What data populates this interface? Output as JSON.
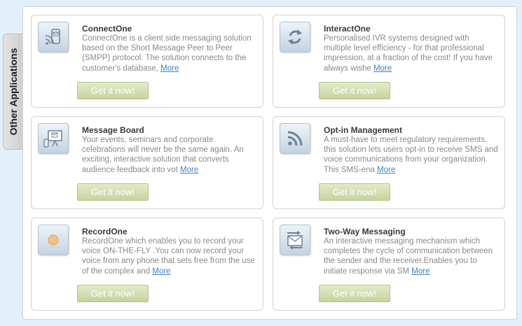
{
  "side_tab": {
    "label": "Other Applications"
  },
  "button_label": "Get it now!",
  "more_label": "More",
  "apps": [
    {
      "title": "ConnectOne",
      "desc": "ConnectOne is a client side messaging solution based on the Short Message Peer to Peer (SMPP) protocol. The solution connects to the customer's database, ",
      "icon": "mobile-message-icon"
    },
    {
      "title": "InteractOne",
      "desc": "Personalised IVR systems designed with multiple level efficiency - for that professional impression, at a fraction of the cost! If you have always wishe ",
      "icon": "refresh-arrows-icon"
    },
    {
      "title": "Message Board",
      "desc": "Your events, seminars and corporate celebrations will never be the same again. An exciting, interactive solution that converts audience feedback into vot ",
      "icon": "presentation-board-icon"
    },
    {
      "title": "Opt-in Management",
      "desc": "A must-have to meet regulatory requirements, this solution lets users opt-in to receive SMS and voice communications from your organization. This SMS-ena ",
      "icon": "rss-feed-icon"
    },
    {
      "title": "RecordOne",
      "desc": "RecordOne which enables you to record your voice ON-THE-FLY .You can now record your voice from any phone that sets free from the use of the complex and  ",
      "icon": "record-dot-icon"
    },
    {
      "title": "Two-Way Messaging",
      "desc": "An interactive messaging mechanism which completes the cycle of communication between the sender and the receiver.Enables you to initiate response via SM ",
      "icon": "two-way-envelope-icon"
    }
  ]
}
